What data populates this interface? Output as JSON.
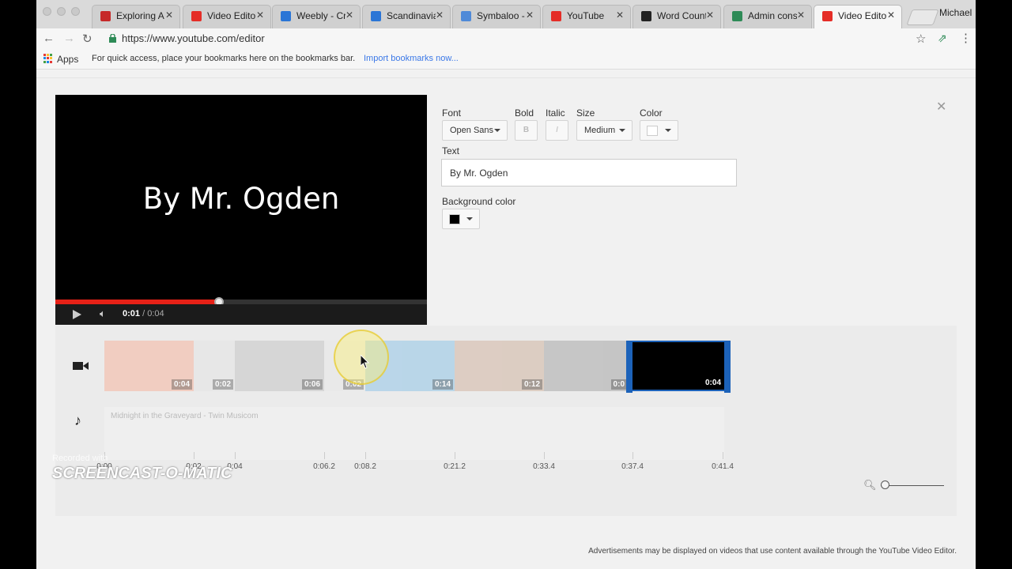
{
  "browser": {
    "tabs": [
      {
        "title": "Exploring A",
        "favicon_color": "#c62828",
        "icon": "gmail-like-icon"
      },
      {
        "title": "Video Editor",
        "favicon_color": "#e52d27",
        "icon": "youtube-icon"
      },
      {
        "title": "Weebly - Cr",
        "favicon_color": "#2a75d6",
        "icon": "weebly-icon"
      },
      {
        "title": "Scandinavia",
        "favicon_color": "#2a75d6",
        "icon": "weebly-icon"
      },
      {
        "title": "Symbaloo -",
        "favicon_color": "#4f8ad8",
        "icon": "symbaloo-icon"
      },
      {
        "title": "YouTube",
        "favicon_color": "#e52d27",
        "icon": "youtube-icon"
      },
      {
        "title": "Word Count",
        "favicon_color": "#222222",
        "icon": "w-icon"
      },
      {
        "title": "Admin cons",
        "favicon_color": "#2e8b57",
        "icon": "admin-icon"
      },
      {
        "title": "Video Editor",
        "favicon_color": "#e52d27",
        "icon": "youtube-icon"
      }
    ],
    "profile_name": "Michael",
    "url": "https://www.youtube.com/editor",
    "bookmarks": {
      "apps_label": "Apps",
      "hint": "For quick access, place your bookmarks here on the bookmarks bar.",
      "import_link": "Import bookmarks now..."
    }
  },
  "preview": {
    "caption": "By Mr. Ogden",
    "time_current": "0:01",
    "time_total": "/ 0:04",
    "progress_fraction": 0.44
  },
  "text_editor": {
    "font_label": "Font",
    "font_value": "Open Sans",
    "bold_label": "Bold",
    "bold_glyph": "B",
    "italic_label": "Italic",
    "italic_glyph": "I",
    "size_label": "Size",
    "size_value": "Medium",
    "color_label": "Color",
    "color_value": "#ffffff",
    "text_label": "Text",
    "text_value": "By Mr. Ogden",
    "bg_label": "Background color",
    "bg_value": "#000000"
  },
  "timeline": {
    "clips": [
      {
        "duration": "0:04",
        "color": "#f3c4b3"
      },
      {
        "duration": "0:02",
        "color": "#e6e6e6"
      },
      {
        "duration": "0:06",
        "color": "#cfcfcf"
      },
      {
        "duration": "0:02",
        "color": "#e9e9e9"
      },
      {
        "duration": "0:14",
        "color": "#a9cfe8"
      },
      {
        "duration": "0:12",
        "color": "#d8c3b5"
      },
      {
        "duration": "0:0",
        "color": "#b9b9b9"
      },
      {
        "duration": "0:04",
        "color": "#000000"
      }
    ],
    "audio_title": "Midnight in the Graveyard - Twin Musicom",
    "ticks": [
      "0:00",
      "0:02",
      "0:04",
      "0:06.2",
      "0:08.2",
      "0:21.2",
      "0:33.4",
      "0:37.4",
      "0:41.4"
    ]
  },
  "footer_note": "Advertisements may be displayed on videos that use content available through the YouTube Video Editor.",
  "watermark": {
    "recorded_with": "Recorded with",
    "brand": "SCREENCAST-O-MATIC"
  }
}
